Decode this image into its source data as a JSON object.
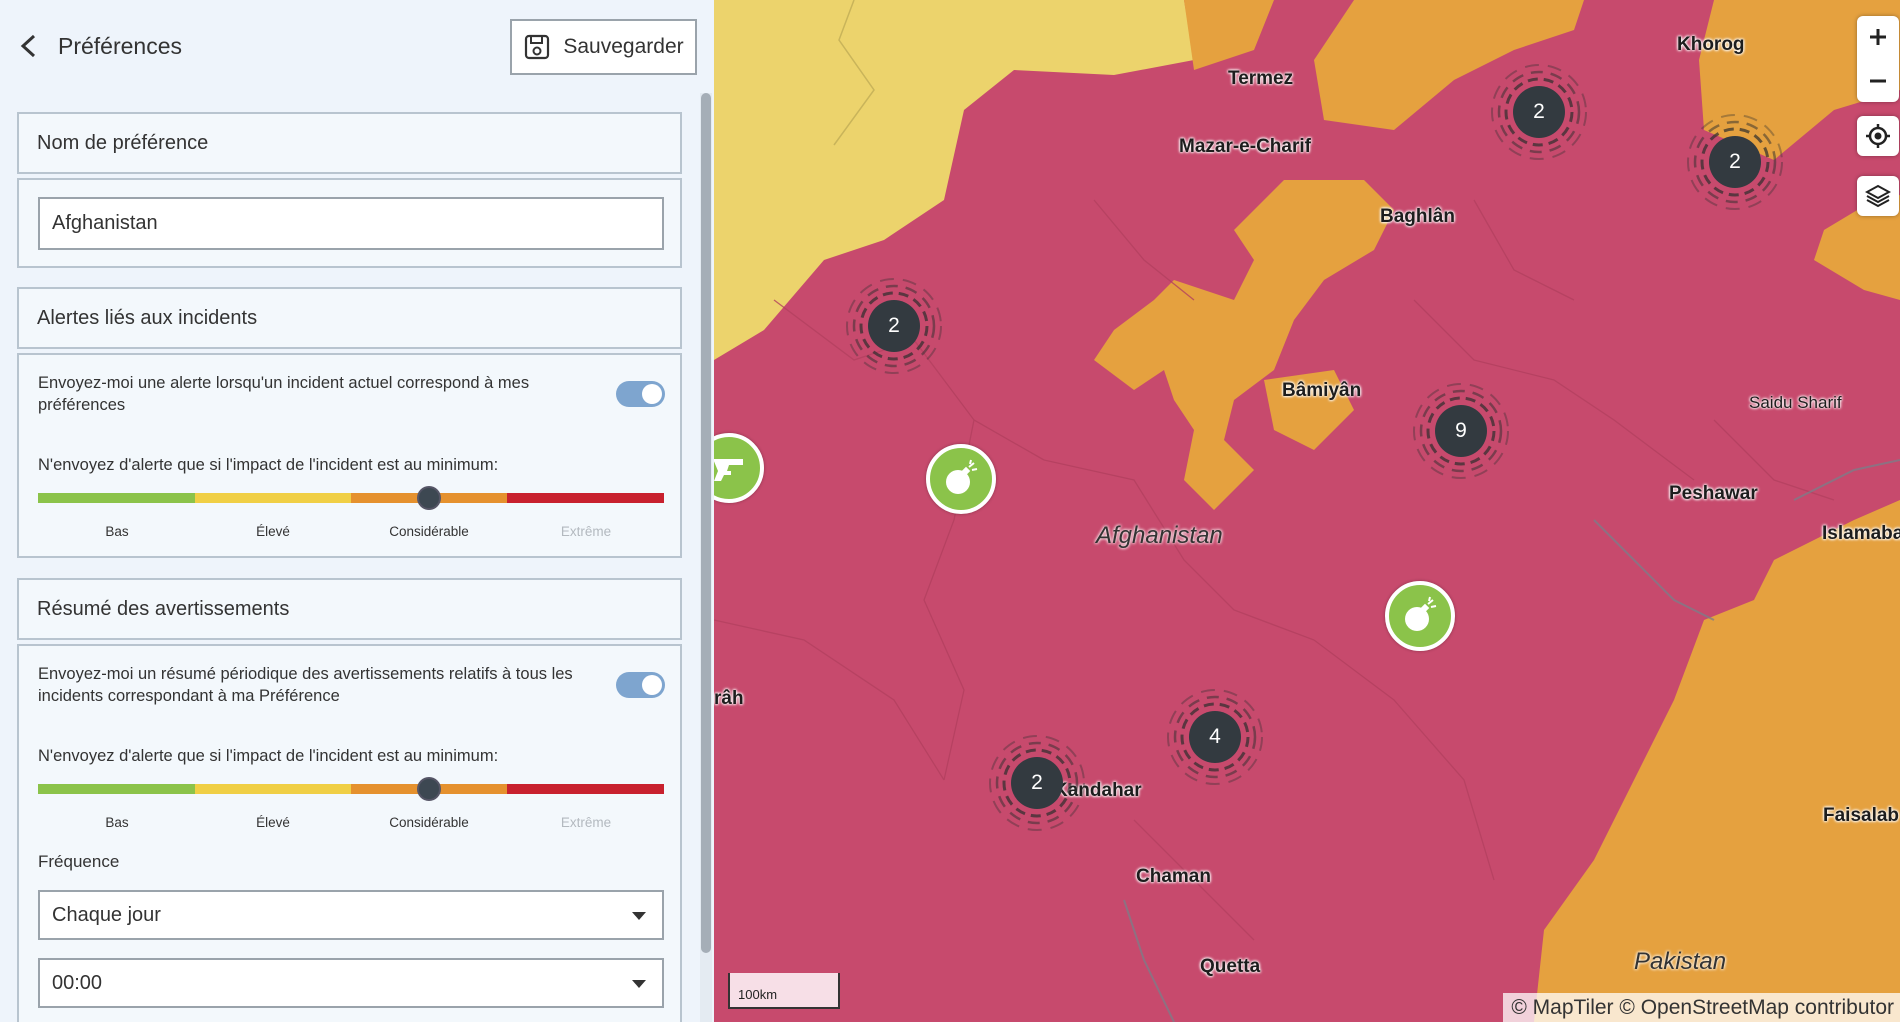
{
  "header": {
    "back_label": "Préférences",
    "save_label": "Sauvegarder"
  },
  "preference_name": {
    "section_title": "Nom de préférence",
    "value": "Afghanistan"
  },
  "incident_alerts": {
    "section_title": "Alertes liés aux incidents",
    "toggle_text": "Envoyez-moi une alerte lorsqu'un incident actuel correspond à mes préférences",
    "toggle_on": true,
    "impact_text": "N'envoyez d'alerte que si l'impact de l'incident est au minimum:",
    "selected_level": "Considérable"
  },
  "summary": {
    "section_title": "Résumé des avertissements",
    "toggle_text": "Envoyez-moi un résumé périodique des avertissements relatifs à tous les incidents correspondant à ma Préférence",
    "toggle_on": true,
    "impact_text": "N'envoyez d'alerte que si l'impact de l'incident est au minimum:",
    "selected_level": "Considérable",
    "frequency_label": "Fréquence",
    "frequency_value": "Chaque jour",
    "time_value": "00:00"
  },
  "levels": [
    "Bas",
    "Élevé",
    "Considérable",
    "Extrême"
  ],
  "level_colors": [
    "#8bc34a",
    "#f0cf45",
    "#e5912e",
    "#c8212e"
  ],
  "map": {
    "country_labels": [
      "Afghanistan",
      "Pakistan"
    ],
    "cities": [
      "Termez",
      "Khorog",
      "Mazar-e-Charif",
      "Baghlân",
      "Bâmiyân",
      "Saidu Sharif",
      "Peshawar",
      "Islamaba",
      "Kandahar",
      "Chaman",
      "Quetta",
      "Faisalab",
      "râh"
    ],
    "clusters": [
      "2",
      "2",
      "2",
      "9",
      "4",
      "2"
    ],
    "incident_icons": [
      "gun-icon",
      "bomb-icon",
      "bomb-icon"
    ],
    "scale_label": "100km",
    "attribution": "© MapTiler © OpenStreetMap contributor",
    "risk_colors": {
      "extreme": "#c74a6d",
      "high": "#e5a13f",
      "moderate": "#ecd36c"
    }
  }
}
